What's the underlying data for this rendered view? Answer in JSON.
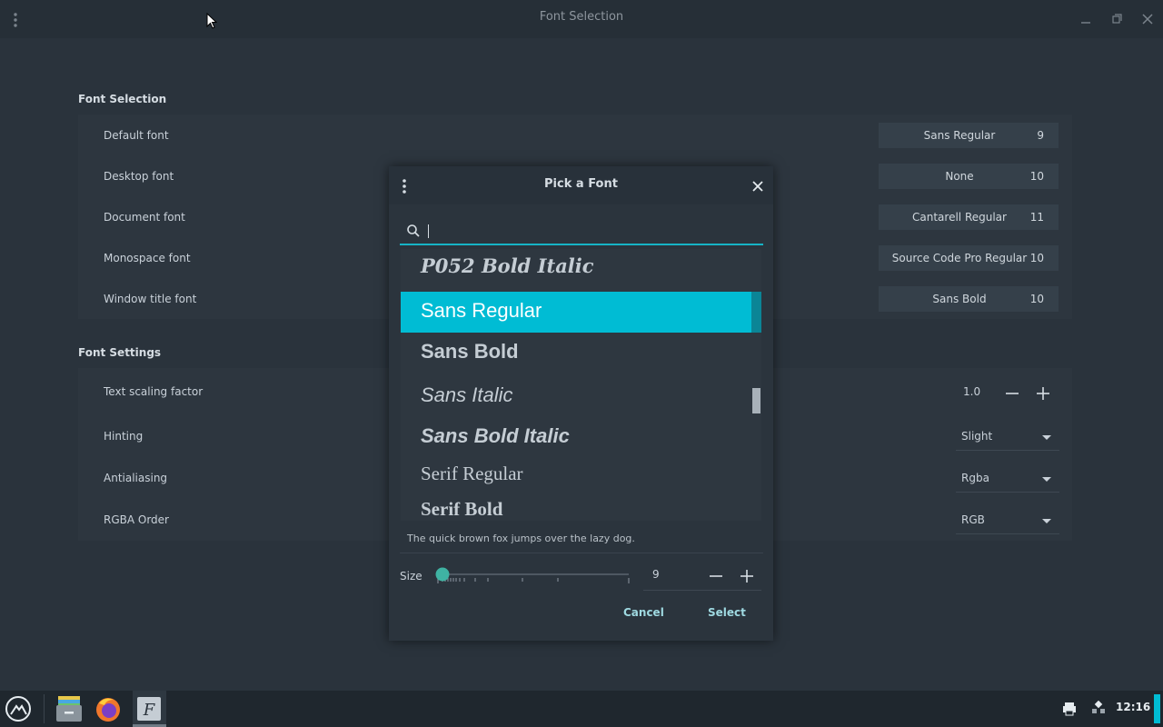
{
  "window": {
    "title": "Font Selection"
  },
  "sections": {
    "font_selection": {
      "title": "Font Selection",
      "rows": [
        {
          "label": "Default font",
          "font": "Sans Regular",
          "size": "9"
        },
        {
          "label": "Desktop font",
          "font": "None",
          "size": "10"
        },
        {
          "label": "Document font",
          "font": "Cantarell Regular",
          "size": "11"
        },
        {
          "label": "Monospace font",
          "font": "Source Code Pro Regular",
          "size": "10"
        },
        {
          "label": "Window title font",
          "font": "Sans Bold",
          "size": "10"
        }
      ]
    },
    "font_settings": {
      "title": "Font Settings",
      "scaling": {
        "label": "Text scaling factor",
        "value": "1.0"
      },
      "hinting": {
        "label": "Hinting",
        "value": "Slight"
      },
      "antialiasing": {
        "label": "Antialiasing",
        "value": "Rgba"
      },
      "rgba_order": {
        "label": "RGBA Order",
        "value": "RGB"
      }
    }
  },
  "dialog": {
    "title": "Pick a Font",
    "search": {
      "value": ""
    },
    "fonts": [
      {
        "name": "P052 Bold Italic",
        "selected": false
      },
      {
        "name": "Sans Regular",
        "selected": true
      },
      {
        "name": "Sans Bold",
        "selected": false
      },
      {
        "name": "Sans Italic",
        "selected": false
      },
      {
        "name": "Sans Bold Italic",
        "selected": false
      },
      {
        "name": "Serif Regular",
        "selected": false
      },
      {
        "name": "Serif Bold",
        "selected": false
      }
    ],
    "preview": "The quick brown fox jumps over the lazy dog.",
    "size": {
      "label": "Size",
      "value": "9",
      "slider_fraction": 0.03
    },
    "cancel_label": "Cancel",
    "select_label": "Select"
  },
  "taskbar": {
    "clock": "12:16"
  },
  "colors": {
    "accent": "#00bcd4",
    "background": "#2a333c"
  }
}
